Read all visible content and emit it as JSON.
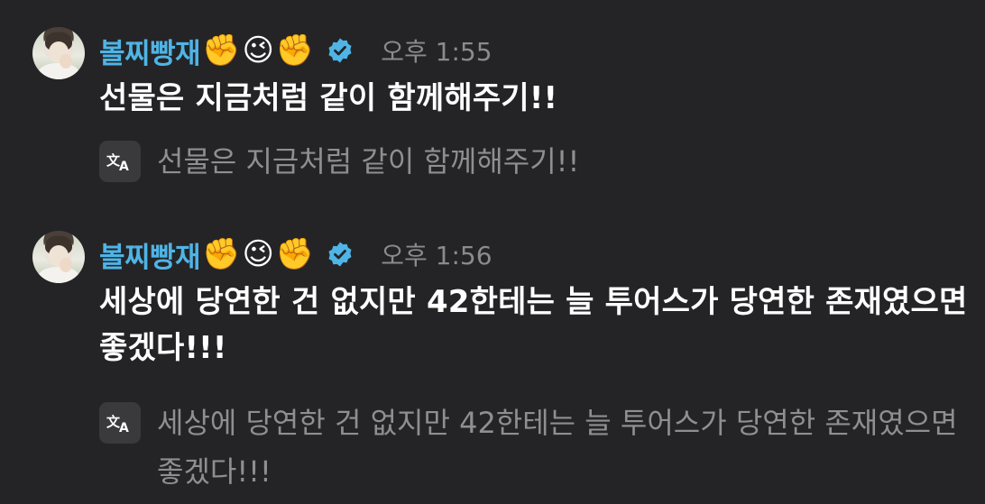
{
  "messages": [
    {
      "author": {
        "name": "볼찌빵재",
        "emojis": [
          "✊",
          "😉",
          "✊"
        ],
        "verified": true
      },
      "timestamp": "오후 1:55",
      "text": "선물은 지금처럼 같이 함께해주기!!",
      "translation": "선물은 지금처럼 같이 함께해주기!!"
    },
    {
      "author": {
        "name": "볼찌빵재",
        "emojis": [
          "✊",
          "😉",
          "✊"
        ],
        "verified": true
      },
      "timestamp": "오후 1:56",
      "text": "세상에 당연한 건 없지만 42한테는 늘 투어스가 당연한 존재였으면 좋겠다!!!",
      "translation": "세상에 당연한 건 없지만 42한테는 늘 투어스가 당연한 존재였으면 좋겠다!!!"
    }
  ],
  "colors": {
    "background": "#242426",
    "username": "#4fb4e6",
    "timestamp": "#8a8a8f",
    "body_text": "#ffffff",
    "translation_text": "#8e8e93",
    "verified_badge": "#4fb4e6"
  },
  "icons": {
    "verified": "verified-badge-icon",
    "translate": "translate-icon"
  }
}
